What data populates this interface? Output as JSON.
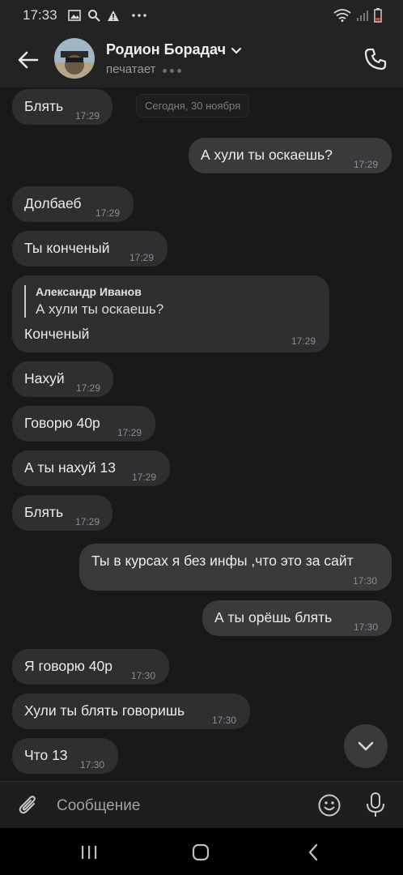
{
  "status_bar": {
    "time": "17:33",
    "left_icons": [
      "gallery-icon",
      "search-icon",
      "warning-icon",
      "more-dots-icon"
    ],
    "right_icons": [
      "wifi-icon",
      "signal-icon",
      "battery-low-icon"
    ]
  },
  "header": {
    "contact_name": "Родион Борадач",
    "status": "печатает"
  },
  "date_badge": "Сегодня, 30 ноября",
  "messages": [
    {
      "text": "Блять",
      "time": "17:29"
    },
    {
      "text": "А хули ты оскаешь?",
      "time": "17:29"
    },
    {
      "text": "Долбаеб",
      "time": "17:29"
    },
    {
      "text": "Ты конченый",
      "time": "17:29"
    },
    {
      "reply_author": "Александр Иванов",
      "reply_text": "А хули ты оскаешь?",
      "text": "Конченый",
      "time": "17:29"
    },
    {
      "text": "Нахуй",
      "time": "17:29"
    },
    {
      "text": "Говорю 40р",
      "time": "17:29"
    },
    {
      "text": "А ты нахуй 13",
      "time": "17:29"
    },
    {
      "text": "Блять",
      "time": "17:29"
    },
    {
      "text": "Ты в курсах я без инфы ,что это за сайт",
      "time": "17:30"
    },
    {
      "text": "А ты орёшь блять",
      "time": "17:30"
    },
    {
      "text": "Я говорю 40р",
      "time": "17:30"
    },
    {
      "text": "Хули ты блять говоришь",
      "time": "17:30"
    },
    {
      "text": "Что 13",
      "time": "17:30"
    }
  ],
  "composer": {
    "placeholder": "Сообщение"
  },
  "colors": {
    "background": "#19191a",
    "bubble_incoming": "#2f2f31",
    "bubble_outgoing": "#3a3a3c",
    "header": "#232324"
  }
}
